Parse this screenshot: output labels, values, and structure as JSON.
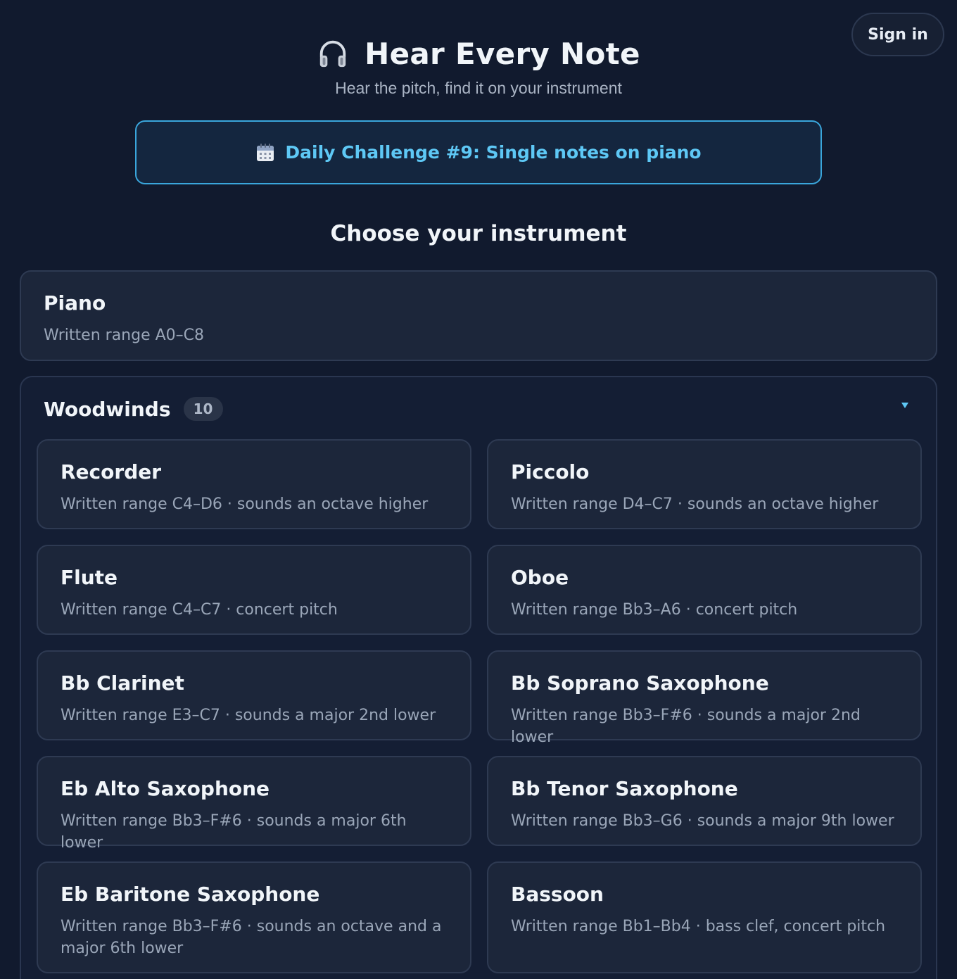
{
  "header": {
    "title": "Hear Every Note",
    "subtitle": "Hear the pitch, find it on your instrument",
    "title_icon": "headphones-icon"
  },
  "auth": {
    "signin_label": "Sign in"
  },
  "daily": {
    "icon": "calendar-icon",
    "label": "Daily Challenge #9: Single notes on piano",
    "accent": "#5ec8f5"
  },
  "section_title": "Choose your instrument",
  "piano": {
    "name": "Piano",
    "desc": "Written range A0–C8"
  },
  "woodwinds": {
    "name": "Woodwinds",
    "count": "10",
    "chevron_icon": "chevron-down-icon",
    "items": [
      {
        "name": "Recorder",
        "desc": "Written range C4–D6 · sounds an octave higher"
      },
      {
        "name": "Piccolo",
        "desc": "Written range D4–C7 · sounds an octave higher"
      },
      {
        "name": "Flute",
        "desc": "Written range C4–C7 · concert pitch"
      },
      {
        "name": "Oboe",
        "desc": "Written range Bb3–A6 · concert pitch"
      },
      {
        "name": "Bb Clarinet",
        "desc": "Written range E3–C7 · sounds a major 2nd lower"
      },
      {
        "name": "Bb Soprano Saxophone",
        "desc": "Written range Bb3–F#6 · sounds a major 2nd lower"
      },
      {
        "name": "Eb Alto Saxophone",
        "desc": "Written range Bb3–F#6 · sounds a major 6th lower"
      },
      {
        "name": "Bb Tenor Saxophone",
        "desc": "Written range Bb3–G6 · sounds a major 9th lower"
      },
      {
        "name": "Eb Baritone Saxophone",
        "desc": "Written range Bb3–F#6 · sounds an octave and a major 6th lower"
      },
      {
        "name": "Bassoon",
        "desc": "Written range Bb1–Bb4 · bass clef, concert pitch"
      }
    ]
  }
}
